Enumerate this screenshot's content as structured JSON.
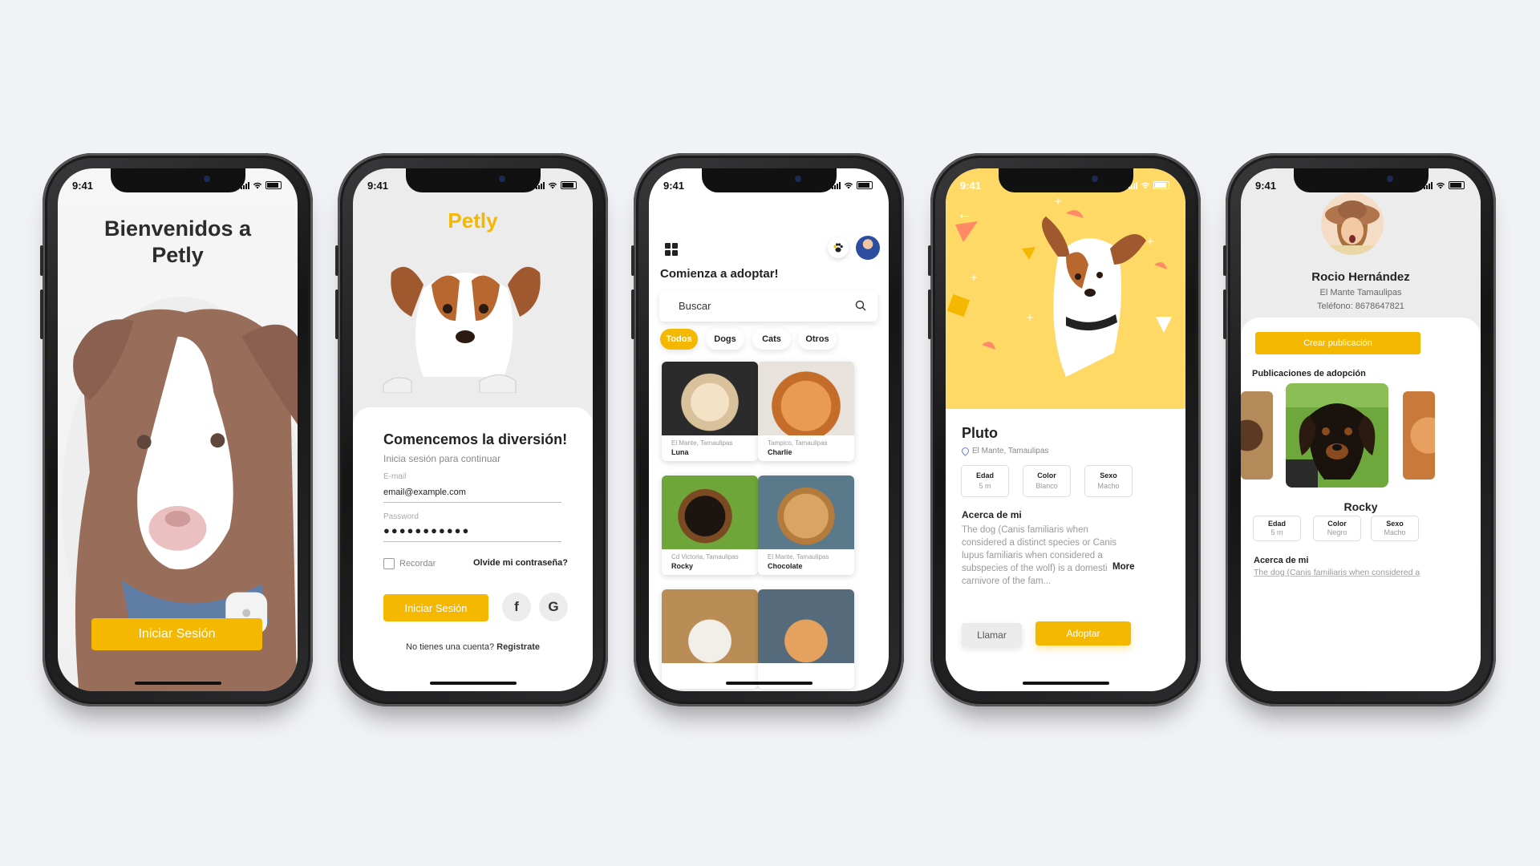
{
  "status": {
    "time": "9:41"
  },
  "welcome": {
    "title_line1": "Bienvenidos a",
    "title_line2": "Petly",
    "login_button": "Iniciar Sesión"
  },
  "login": {
    "brand": "Petly",
    "heading": "Comencemos la diversión!",
    "subheading": "Inicia sesión para continuar",
    "email_label": "E-mail",
    "email_value": "email@example.com",
    "password_label": "Password",
    "password_value": "●●●●●●●●●●●",
    "remember_label": "Recordar",
    "forgot_label": "Olvide mi contraseña?",
    "login_button": "Iniciar Sesión",
    "facebook_glyph": "f",
    "google_glyph": "G",
    "signup_prompt": "No tienes una cuenta?",
    "signup_link": "Registrate"
  },
  "feed": {
    "heading": "Comienza a adoptar!",
    "search_placeholder": "Buscar",
    "filters": [
      {
        "label": "Todos",
        "active": true
      },
      {
        "label": "Dogs",
        "active": false
      },
      {
        "label": "Cats",
        "active": false
      },
      {
        "label": "Otros",
        "active": false
      }
    ],
    "pets": [
      {
        "location": "El Mante, Tamaulipas",
        "name": "Luna"
      },
      {
        "location": "Tampico, Tamaulipas",
        "name": "Charlie"
      },
      {
        "location": "Cd Victoria, Tamaulipas",
        "name": "Rocky"
      },
      {
        "location": "El Mante, Tamaulipas",
        "name": "Chocolate"
      },
      {
        "location": "",
        "name": ""
      },
      {
        "location": "",
        "name": ""
      }
    ]
  },
  "detail": {
    "name": "Pluto",
    "location": "El Mante, Tamaulipas",
    "attributes": [
      {
        "key": "Edad",
        "value": "5 m"
      },
      {
        "key": "Color",
        "value": "Blanco"
      },
      {
        "key": "Sexo",
        "value": "Macho"
      }
    ],
    "about_title": "Acerca de mi",
    "about_text": "The dog (Canis familiaris when considered a distinct species or Canis lupus familiaris when considered a subspecies of the wolf) is a domesticated carnivore of the fam...",
    "more_label": "More",
    "call_button": "Llamar",
    "adopt_button": "Adoptar"
  },
  "profile": {
    "name": "Rocio Hernández",
    "city": "El Mante Tamaulipas",
    "phone": "Teléfono: 8678647821",
    "create_button": "Crear publicación",
    "section_title": "Publicaciones de adopción",
    "pet_name": "Rocky",
    "attributes": [
      {
        "key": "Edad",
        "value": "5 m"
      },
      {
        "key": "Color",
        "value": "Negro"
      },
      {
        "key": "Sexo",
        "value": "Macho"
      }
    ],
    "about_title": "Acerca de mi",
    "about_text": "The dog (Canis familiaris when considered a"
  },
  "colors": {
    "accent": "#f5b800",
    "background": "#f1f2f6",
    "hero_yellow": "#ffd966"
  }
}
